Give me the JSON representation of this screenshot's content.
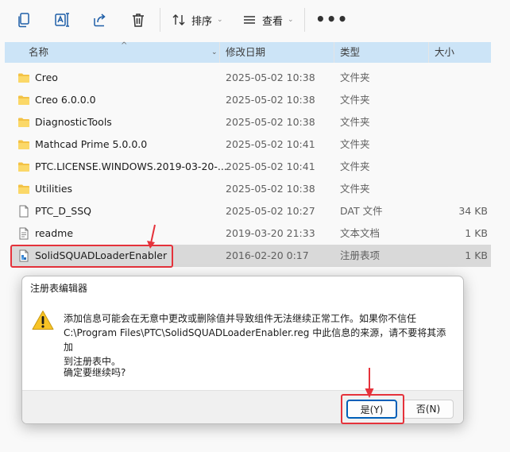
{
  "toolbar": {
    "sort_label": "排序",
    "view_label": "查看",
    "more_label": "•••"
  },
  "columns": {
    "name": "名称",
    "date": "修改日期",
    "type": "类型",
    "size": "大小"
  },
  "files": [
    {
      "name": "Creo",
      "date": "2025-05-02 10:38",
      "type": "文件夹",
      "size": "",
      "icon": "folder-icon"
    },
    {
      "name": "Creo 6.0.0.0",
      "date": "2025-05-02 10:38",
      "type": "文件夹",
      "size": "",
      "icon": "folder-icon"
    },
    {
      "name": "DiagnosticTools",
      "date": "2025-05-02 10:38",
      "type": "文件夹",
      "size": "",
      "icon": "folder-icon"
    },
    {
      "name": "Mathcad Prime 5.0.0.0",
      "date": "2025-05-02 10:41",
      "type": "文件夹",
      "size": "",
      "icon": "folder-icon"
    },
    {
      "name": "PTC.LICENSE.WINDOWS.2019-03-20-...",
      "date": "2025-05-02 10:41",
      "type": "文件夹",
      "size": "",
      "icon": "folder-icon"
    },
    {
      "name": "Utilities",
      "date": "2025-05-02 10:38",
      "type": "文件夹",
      "size": "",
      "icon": "folder-icon"
    },
    {
      "name": "PTC_D_SSQ",
      "date": "2025-05-02 10:27",
      "type": "DAT 文件",
      "size": "34 KB",
      "icon": "file-icon"
    },
    {
      "name": "readme",
      "date": "2019-03-20 21:33",
      "type": "文本文档",
      "size": "1 KB",
      "icon": "text-file-icon"
    },
    {
      "name": "SolidSQUADLoaderEnabler",
      "date": "2016-02-20 0:17",
      "type": "注册表项",
      "size": "1 KB",
      "icon": "registry-file-icon"
    }
  ],
  "dialog": {
    "title": "注册表编辑器",
    "message_line1": "添加信息可能会在无意中更改或删除值并导致组件无法继续正常工作。如果你不信任",
    "message_line2": "C:\\Program Files\\PTC\\SolidSQUADLoaderEnabler.reg 中此信息的来源，请不要将其添加",
    "message_line3": "到注册表中。",
    "question": "确定要继续吗?",
    "yes_label": "是(Y)",
    "no_label": "否(N)"
  },
  "colors": {
    "accent": "#005fb8",
    "annotation_red": "#e5323b",
    "header_blue": "#cce4f7",
    "selected_row": "#d9d9d9",
    "folder": "#f3c245"
  }
}
